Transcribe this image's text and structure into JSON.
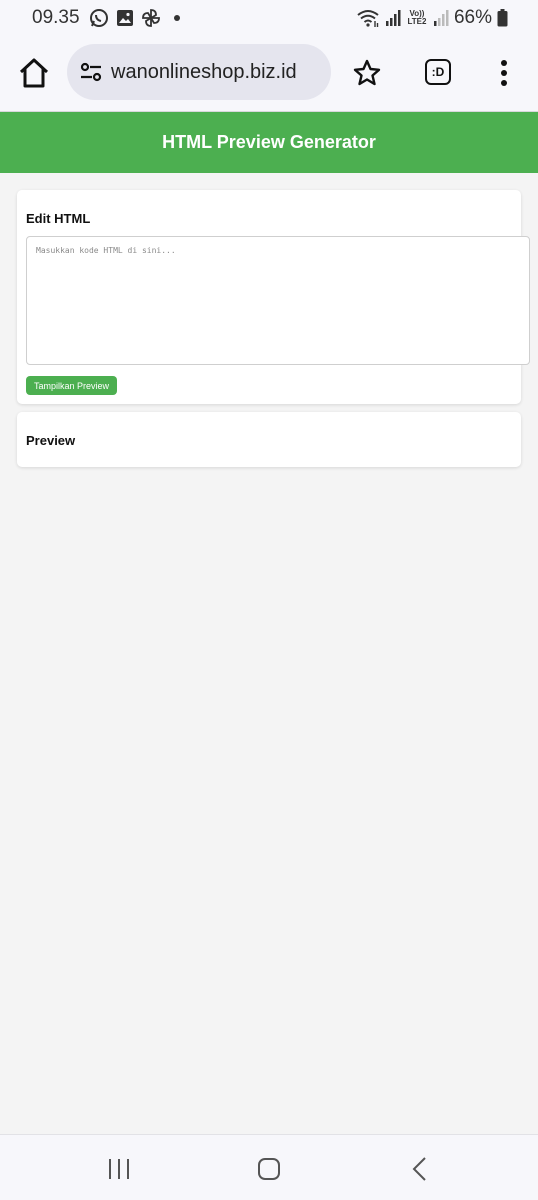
{
  "status_bar": {
    "time": "09.35",
    "battery": "66%",
    "network_label": "Vo)) LTE2",
    "notification_icons": [
      "whatsapp-icon",
      "gallery-icon",
      "pinwheel-icon"
    ]
  },
  "browser": {
    "url": "wanonlineshop.biz.id",
    "tabs_label": ":D"
  },
  "app": {
    "title": "HTML Preview Generator",
    "accent_color": "#4caf50"
  },
  "editor": {
    "title": "Edit HTML",
    "placeholder": "Masukkan kode HTML di sini...",
    "value": "",
    "button_label": "Tampilkan Preview"
  },
  "preview": {
    "title": "Preview"
  }
}
